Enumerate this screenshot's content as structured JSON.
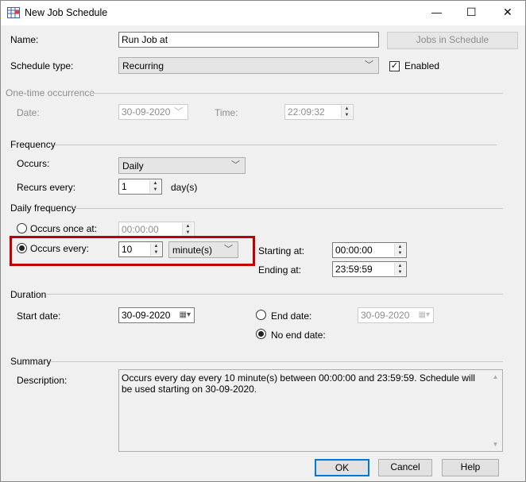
{
  "window": {
    "title": "New Job Schedule",
    "min": "—",
    "max": "☐",
    "close": "✕"
  },
  "name": {
    "label": "Name:",
    "value": "Run Job at"
  },
  "jobs_button": "Jobs in Schedule",
  "schedule_type": {
    "label": "Schedule type:",
    "value": "Recurring"
  },
  "enabled": {
    "label": "Enabled",
    "checked": true
  },
  "one_time": {
    "group": "One-time occurrence",
    "date_label": "Date:",
    "date": "30-09-2020",
    "time_label": "Time:",
    "time": "22:09:32"
  },
  "frequency": {
    "group": "Frequency",
    "occurs_label": "Occurs:",
    "occurs": "Daily",
    "recurs_label": "Recurs every:",
    "recurs": "1",
    "unit": "day(s)"
  },
  "daily": {
    "group": "Daily frequency",
    "once_label": "Occurs once at:",
    "once_time": "00:00:00",
    "every_label": "Occurs every:",
    "every_value": "10",
    "every_unit": "minute(s)",
    "start_label": "Starting at:",
    "start": "00:00:00",
    "end_label": "Ending at:",
    "end": "23:59:59"
  },
  "duration": {
    "group": "Duration",
    "start_label": "Start date:",
    "start": "30-09-2020",
    "end_label": "End date:",
    "end": "30-09-2020",
    "no_end_label": "No end date:"
  },
  "summary": {
    "group": "Summary",
    "desc_label": "Description:",
    "desc": "Occurs every day every 10 minute(s) between 00:00:00 and 23:59:59. Schedule will be used starting on 30-09-2020."
  },
  "buttons": {
    "ok": "OK",
    "cancel": "Cancel",
    "help": "Help"
  },
  "colors": {
    "highlight": "#c00000",
    "default_button": "#0078d7"
  }
}
